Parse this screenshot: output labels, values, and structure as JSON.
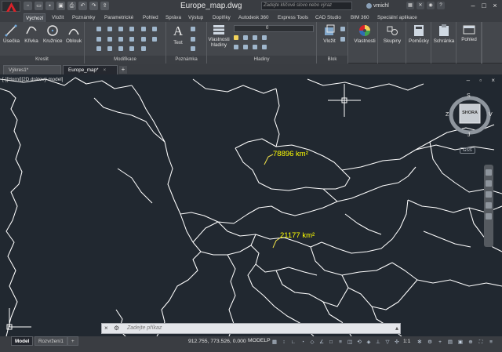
{
  "titlebar": {
    "doc_title": "Europe_map.dwg",
    "search_placeholder": "Zadejte klíčové slovo nebo výraz",
    "user": "vmichl",
    "qat_icons": [
      "new-icon",
      "open-icon",
      "save-icon",
      "saveas-icon",
      "print-icon",
      "undo-icon",
      "redo-icon",
      "share-icon"
    ]
  },
  "ribbon_tabs": [
    "Výchozí",
    "Vložit",
    "Poznámky",
    "Parametrické",
    "Pohled",
    "Správa",
    "Výstup",
    "Doplňky",
    "Autodesk 360",
    "Express Tools",
    "CAD Studio",
    "BIM 360",
    "Speciální aplikace"
  ],
  "ribbon": {
    "draw": {
      "label": "Kreslit",
      "tools": [
        "Úsečka",
        "Křivka",
        "Kružnice",
        "Oblouk"
      ]
    },
    "modify": {
      "label": "Modifikace"
    },
    "annotation": {
      "label": "Poznámka",
      "tools": [
        "Text"
      ]
    },
    "layers": {
      "label": "Hladiny",
      "properties_button": "Vlastnosti hladiny",
      "layer_combo_value": "0"
    },
    "block": {
      "label": "Blok",
      "insert_button": "Vložit"
    },
    "properties_button": "Vlastnosti",
    "groups_button": "Skupiny",
    "utilities_button": "Pomůcky",
    "clipboard_button": "Schránka",
    "view_button": "Pohled"
  },
  "doc_tabs": {
    "tabs": [
      "Výkres1*",
      "Europe_map*"
    ],
    "active_index": 1,
    "close_glyph": "×",
    "add_glyph": "+"
  },
  "viewport": {
    "label": "[-][Horní][2D drátový model]",
    "controls": "– ▫ ×",
    "viewcube": {
      "top_label": "SHORA",
      "north": "S",
      "south": "J",
      "west": "Z",
      "east": "V"
    },
    "wcs_label": "GSS",
    "area_labels": [
      "78896 km²",
      "21177 km²"
    ],
    "label_color": "#ffff00",
    "line_color": "#ffffff"
  },
  "command_line": {
    "prompt": "Zadejte příkaz"
  },
  "layout_tabs": [
    "Model",
    "Rozvržení1",
    "+"
  ],
  "statusbar": {
    "coords": "912.755, 773.526, 0.000",
    "space": "MODELP",
    "scale": "1:1"
  }
}
